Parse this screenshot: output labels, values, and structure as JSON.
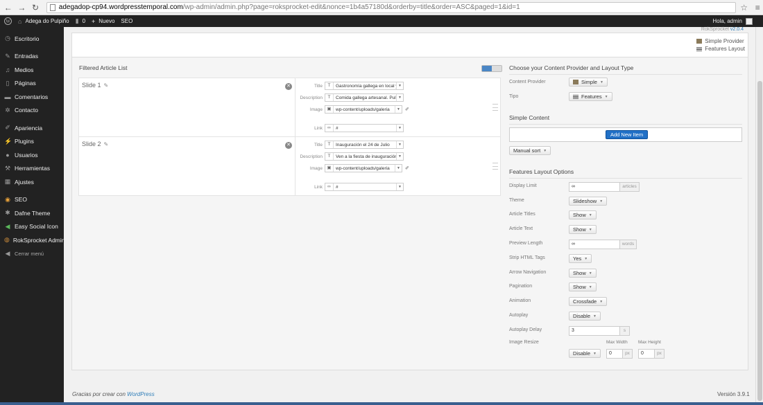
{
  "browser": {
    "url_host": "adegadop-cp94.wordpresstemporal.com",
    "url_rest": "/wp-admin/admin.php?page=roksprocket-edit&nonce=1b4a57180d&orderby=title&order=ASC&paged=1&id=1"
  },
  "adminbar": {
    "site_name": "Adega do Pulpiño",
    "comments_count": "0",
    "new_label": "Nuevo",
    "seo_label": "SEO",
    "greeting": "Hola, admin"
  },
  "sidebar": {
    "items": [
      {
        "label": "Escritorio",
        "icon": "dashboard-icon"
      },
      {
        "label": "Entradas",
        "icon": "pin-icon"
      },
      {
        "label": "Medios",
        "icon": "media-icon"
      },
      {
        "label": "Páginas",
        "icon": "page-icon"
      },
      {
        "label": "Comentarios",
        "icon": "comment-icon"
      },
      {
        "label": "Contacto",
        "icon": "gear-icon"
      },
      {
        "label": "Apariencia",
        "icon": "brush-icon"
      },
      {
        "label": "Plugins",
        "icon": "plug-icon"
      },
      {
        "label": "Usuarios",
        "icon": "user-icon"
      },
      {
        "label": "Herramientas",
        "icon": "wrench-icon"
      },
      {
        "label": "Ajustes",
        "icon": "settings-icon"
      },
      {
        "label": "SEO",
        "icon": "seo-icon"
      },
      {
        "label": "Dafne Theme",
        "icon": "theme-icon"
      },
      {
        "label": "Easy Social Icon",
        "icon": "share-icon"
      },
      {
        "label": "RokSprocket Admin",
        "icon": "rocket-icon"
      }
    ],
    "collapse_label": "Cerrar menú"
  },
  "plugin": {
    "name": "RokSprocket",
    "version": "v2.0.4",
    "provider_tabs": [
      "Simple Provider",
      "Features Layout"
    ]
  },
  "article_list": {
    "title": "Filtered Article List",
    "field_labels": {
      "title": "Title",
      "description": "Description",
      "image": "Image",
      "link": "Link"
    },
    "slides": [
      {
        "name": "Slide 1",
        "title": "Gastronomía gallega en local y",
        "description": "Comida gallega artesanal. Pulpo",
        "image": "wp-content/uploads/galeria",
        "link": "#"
      },
      {
        "name": "Slide 2",
        "title": "Inauguración el 24 de Julio",
        "description": "Ven a la fiesta de inauguración",
        "image": "wp-content/uploads/galeria",
        "link": "#"
      }
    ]
  },
  "provider_section": {
    "title": "Choose your Content Provider and Layout Type",
    "content_provider_label": "Content Provider",
    "content_provider_value": "Simple",
    "tipo_label": "Tipo",
    "tipo_value": "Features"
  },
  "simple_content": {
    "title": "Simple Content",
    "add_button": "Add New Item",
    "sort_button": "Manual sort"
  },
  "layout_options": {
    "title": "Features Layout Options",
    "display_limit": {
      "label": "Display Limit",
      "value": "∞",
      "addon": "articles"
    },
    "theme": {
      "label": "Theme",
      "value": "Slideshow"
    },
    "article_titles": {
      "label": "Article Titles",
      "value": "Show"
    },
    "article_text": {
      "label": "Article Text",
      "value": "Show"
    },
    "preview_length": {
      "label": "Preview Length",
      "value": "∞",
      "addon": "words"
    },
    "strip_html": {
      "label": "Strip HTML Tags",
      "value": "Yes"
    },
    "arrow_nav": {
      "label": "Arrow Navigation",
      "value": "Show"
    },
    "pagination": {
      "label": "Pagination",
      "value": "Show"
    },
    "animation": {
      "label": "Animation",
      "value": "Crossfade"
    },
    "autoplay": {
      "label": "Autoplay",
      "value": "Disable"
    },
    "autoplay_delay": {
      "label": "Autoplay Delay",
      "value": "3",
      "addon": "s"
    },
    "image_resize": {
      "label": "Image Resize",
      "value": "Disable",
      "max_width_label": "Max Width",
      "max_width": "0",
      "max_height_label": "Max Height",
      "max_height": "0",
      "unit": "px"
    }
  },
  "footer": {
    "credit_prefix": "Gracias por crear con ",
    "credit_link": "WordPress",
    "version": "Versión 3.9.1"
  }
}
